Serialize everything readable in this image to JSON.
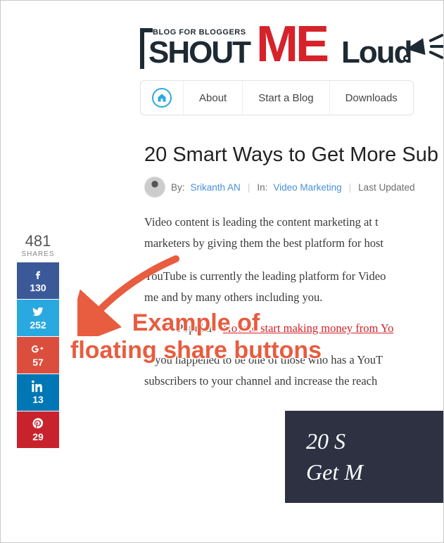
{
  "logo": {
    "tagline": "BLOG FOR BLOGGERS",
    "part_shout": "SHOUT",
    "part_me": "ME",
    "part_loud": "Loud"
  },
  "nav": {
    "home": "Home",
    "about": "About",
    "start": "Start a Blog",
    "downloads": "Downloads"
  },
  "article": {
    "title": "20 Smart Ways to Get More Sub",
    "by_label": "By:",
    "author": "Srikanth AN",
    "in_label": "In:",
    "category": "Video Marketing",
    "updated_label": "Last Updated",
    "p1": "Video content is leading the content marketing at t",
    "p2": "marketers by giving them the best platform for host",
    "p3": "YouTube is currently the leading platform for Video",
    "p4": "me and by many others including you.",
    "bullet_prefix": "Popular:",
    "bullet_link": "How to start making money from Yo",
    "p5": "If you happened to be one of those who has a YouT",
    "p6": "subscribers to your channel and increase the reach",
    "banner_line1": "20 S",
    "banner_line2": "Get M"
  },
  "share": {
    "total": "481",
    "label": "SHARES",
    "facebook": "130",
    "twitter": "252",
    "googleplus": "57",
    "linkedin": "13",
    "pinterest": "29"
  },
  "annotation": {
    "line1": "Example of",
    "line2": "floating share buttons"
  },
  "colors": {
    "accent_red": "#d6222a",
    "annotation": "#e85c3f",
    "link_blue": "#4a90d9"
  }
}
